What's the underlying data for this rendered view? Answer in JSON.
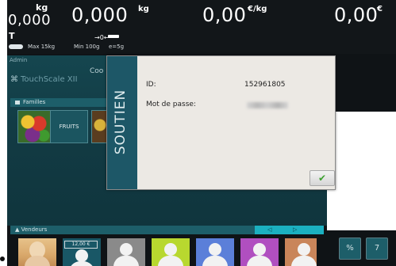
{
  "scale": {
    "weight_value": "0,000",
    "weight_unit": "kg",
    "tare_label": "T",
    "tare_value": "0,000",
    "tare_unit": "kg",
    "price_per_kg": "0,00",
    "price_per_kg_unit": "€/kg",
    "total_price": "0,00",
    "total_price_unit": "€",
    "max_label": "Max 15kg",
    "min_label": "Min 100g",
    "e_label": "e=5g",
    "zero_symbol": "→0←"
  },
  "main": {
    "admin_label": "Admin",
    "logo_text": "TouchScale XII",
    "logo_icon": "touch-icon",
    "cod_label": "Coo"
  },
  "families": {
    "header": "Familles",
    "tiles": [
      {
        "label": "FRUITS"
      }
    ]
  },
  "vendeurs": {
    "header": "Vendeurs",
    "prev_arrow": "◁",
    "next_arrow": "▷",
    "first_price": "12,00 €",
    "colors": [
      "#d9a86b",
      "#195766",
      "#8a8a8a",
      "#b8d82f",
      "#5b7fd9",
      "#2f59c8",
      "#b04fc0",
      "#c9855a"
    ]
  },
  "buttons": {
    "calculator_glyph": "%",
    "seven": "7"
  },
  "modal": {
    "side_title": "SOUTIEN",
    "id_label": "ID:",
    "id_value": "152961805",
    "password_label": "Mot de passe:",
    "ok_glyph": "✔"
  },
  "colors": {
    "accent_teal": "#1d5e69",
    "modal_side": "#1d5767",
    "ok_green": "#3ea132"
  }
}
